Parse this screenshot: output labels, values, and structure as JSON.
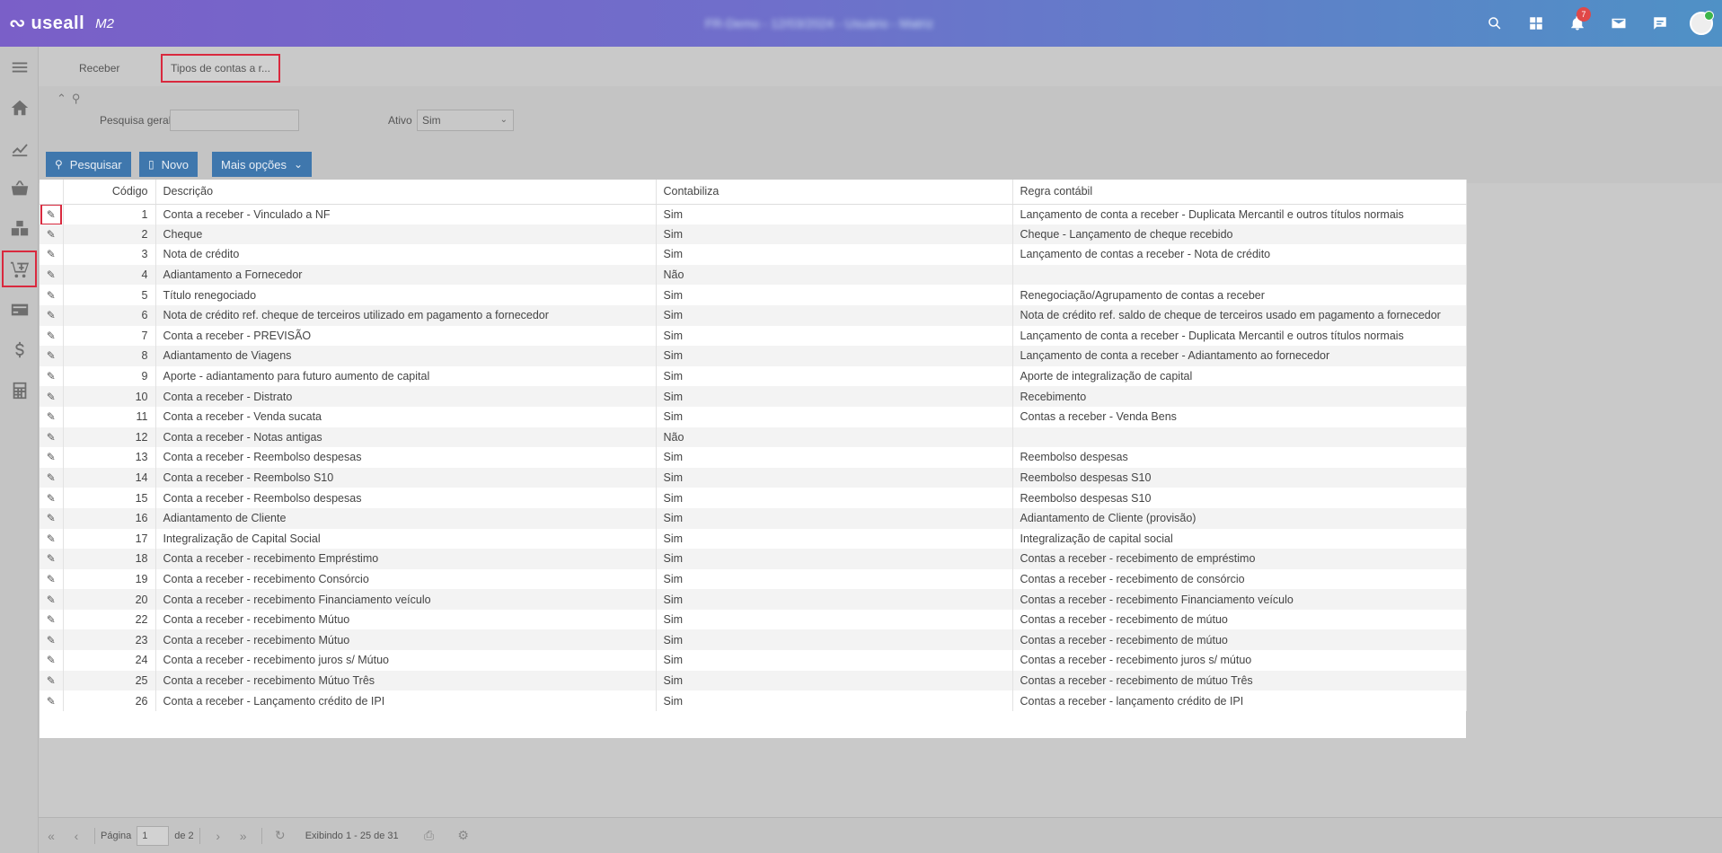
{
  "app": {
    "logo_text": "useall",
    "logo_suffix": "M2",
    "blurred_title": "FR-Demo - 12/03/2024 - Usuário - Matriz",
    "notification_count": "7",
    "accent_red": "#d9293e",
    "header_gradient_start": "#7a5fc8",
    "header_gradient_end": "#4f91c6"
  },
  "header_icons": [
    "search-icon",
    "apps-icon",
    "bell-icon",
    "mail-icon",
    "chat-icon",
    "avatar"
  ],
  "sidebar": [
    "menu-icon",
    "home-icon",
    "chart-icon",
    "basket-icon",
    "boxes-icon",
    "cart-receive-icon",
    "card-icon",
    "dollar-icon",
    "calculator-icon"
  ],
  "tabs": [
    {
      "label": "Receber"
    },
    {
      "label": "Tipos de contas a r..."
    }
  ],
  "filters": {
    "general_search_label": "Pesquisa geral",
    "general_search_value": "",
    "active_label": "Ativo",
    "active_value": "Sim"
  },
  "buttons": {
    "search": "Pesquisar",
    "new": "Novo",
    "more": "Mais opções"
  },
  "table": {
    "columns": {
      "code": "Código",
      "description": "Descrição",
      "accounting": "Contabiliza",
      "rule": "Regra contábil"
    },
    "rows": [
      {
        "code": "1",
        "description": "Conta a receber - Vinculado a NF",
        "accounting": "Sim",
        "rule": "Lançamento de conta a receber - Duplicata Mercantil e outros títulos normais"
      },
      {
        "code": "2",
        "description": "Cheque",
        "accounting": "Sim",
        "rule": "Cheque - Lançamento de cheque recebido"
      },
      {
        "code": "3",
        "description": "Nota de crédito",
        "accounting": "Sim",
        "rule": "Lançamento de contas a receber - Nota de crédito"
      },
      {
        "code": "4",
        "description": "Adiantamento a Fornecedor",
        "accounting": "Não",
        "rule": ""
      },
      {
        "code": "5",
        "description": "Título renegociado",
        "accounting": "Sim",
        "rule": "Renegociação/Agrupamento de contas a receber"
      },
      {
        "code": "6",
        "description": "Nota de crédito ref. cheque de terceiros utilizado em pagamento a fornecedor",
        "accounting": "Sim",
        "rule": "Nota de crédito ref. saldo de cheque de terceiros usado em pagamento a fornecedor"
      },
      {
        "code": "7",
        "description": "Conta a receber - PREVISÃO",
        "accounting": "Sim",
        "rule": "Lançamento de conta a receber - Duplicata Mercantil e outros títulos normais"
      },
      {
        "code": "8",
        "description": "Adiantamento de Viagens",
        "accounting": "Sim",
        "rule": "Lançamento de conta a receber - Adiantamento ao fornecedor"
      },
      {
        "code": "9",
        "description": "Aporte - adiantamento para futuro aumento de capital",
        "accounting": "Sim",
        "rule": "Aporte de integralização de capital"
      },
      {
        "code": "10",
        "description": "Conta a receber - Distrato",
        "accounting": "Sim",
        "rule": "Recebimento"
      },
      {
        "code": "11",
        "description": "Conta a receber - Venda sucata",
        "accounting": "Sim",
        "rule": "Contas a receber - Venda Bens"
      },
      {
        "code": "12",
        "description": "Conta a receber - Notas antigas",
        "accounting": "Não",
        "rule": ""
      },
      {
        "code": "13",
        "description": "Conta a receber - Reembolso despesas",
        "accounting": "Sim",
        "rule": "Reembolso despesas"
      },
      {
        "code": "14",
        "description": "Conta a receber - Reembolso S10",
        "accounting": "Sim",
        "rule": "Reembolso despesas S10"
      },
      {
        "code": "15",
        "description": "Conta a receber - Reembolso despesas",
        "accounting": "Sim",
        "rule": "Reembolso despesas S10"
      },
      {
        "code": "16",
        "description": "Adiantamento de Cliente",
        "accounting": "Sim",
        "rule": "Adiantamento de Cliente (provisão)"
      },
      {
        "code": "17",
        "description": "Integralização de Capital Social",
        "accounting": "Sim",
        "rule": "Integralização de capital social"
      },
      {
        "code": "18",
        "description": "Conta a receber - recebimento Empréstimo",
        "accounting": "Sim",
        "rule": "Contas a receber - recebimento de empréstimo"
      },
      {
        "code": "19",
        "description": "Conta a receber - recebimento Consórcio",
        "accounting": "Sim",
        "rule": "Contas a receber - recebimento de consórcio"
      },
      {
        "code": "20",
        "description": "Conta a receber - recebimento Financiamento veículo",
        "accounting": "Sim",
        "rule": "Contas a receber - recebimento Financiamento veículo"
      },
      {
        "code": "22",
        "description": "Conta a receber - recebimento Mútuo",
        "accounting": "Sim",
        "rule": "Contas a receber - recebimento de mútuo"
      },
      {
        "code": "23",
        "description": "Conta a receber - recebimento Mútuo",
        "accounting": "Sim",
        "rule": "Contas a receber - recebimento de mútuo"
      },
      {
        "code": "24",
        "description": "Conta a receber - recebimento juros s/ Mútuo",
        "accounting": "Sim",
        "rule": "Contas a receber - recebimento juros s/ mútuo"
      },
      {
        "code": "25",
        "description": "Conta a receber - recebimento Mútuo Três",
        "accounting": "Sim",
        "rule": "Contas a receber - recebimento de mútuo Três"
      },
      {
        "code": "26",
        "description": "Conta a receber - Lançamento crédito de IPI",
        "accounting": "Sim",
        "rule": "Contas a receber - lançamento crédito de IPI"
      }
    ]
  },
  "pager": {
    "page_label": "Página",
    "page_value": "1",
    "of_label": "de 2",
    "showing": "Exibindo 1 - 25 de 31"
  }
}
